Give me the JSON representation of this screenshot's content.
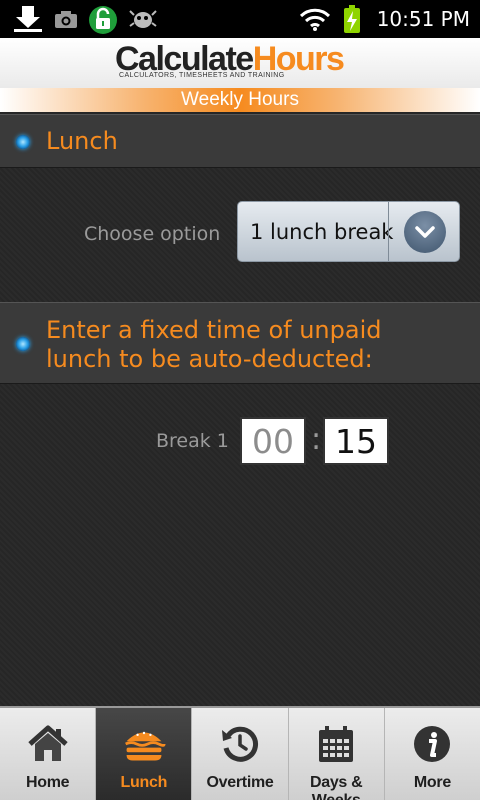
{
  "status_bar": {
    "time": "10:51 PM",
    "icons": [
      "download-icon",
      "camera-icon",
      "lock-icon",
      "bug-icon",
      "wifi-icon",
      "battery-charging-icon"
    ]
  },
  "header": {
    "logo_part1": "Calculate",
    "logo_part2": "Hours",
    "tagline": "CALCULATORS, TIMESHEETS AND TRAINING",
    "subtitle": "Weekly Hours"
  },
  "lunch_section": {
    "title": "Lunch",
    "choose_label": "Choose option",
    "selected_option": "1 lunch break"
  },
  "deduct_section": {
    "title_line1": "Enter a fixed time of unpaid",
    "title_line2": "lunch to be auto-deducted:",
    "break_label": "Break 1",
    "hours": "00",
    "colon": ":",
    "minutes": "15"
  },
  "tabs": [
    {
      "label": "Home",
      "icon": "home-icon",
      "active": false
    },
    {
      "label": "Lunch",
      "icon": "burger-icon",
      "active": true
    },
    {
      "label": "Overtime",
      "icon": "clock-icon",
      "active": false
    },
    {
      "label": "Days & Weeks",
      "icon": "calendar-icon",
      "active": false
    },
    {
      "label": "More",
      "icon": "info-icon",
      "active": false
    }
  ],
  "colors": {
    "accent": "#f68b1f",
    "background": "#262626",
    "section": "#3a3a3a",
    "radio": "#2aa0e8"
  }
}
